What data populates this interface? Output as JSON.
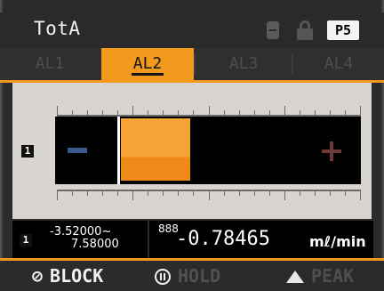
{
  "header": {
    "title": "TotA",
    "preset": "P5"
  },
  "tabs": [
    {
      "label": "AL1",
      "active": false
    },
    {
      "label": "AL2",
      "active": true
    },
    {
      "label": "AL3",
      "active": false
    },
    {
      "label": "AL4",
      "active": false
    }
  ],
  "channel": "1",
  "bar": {
    "negative_symbol": "−",
    "positive_symbol": "+"
  },
  "reading": {
    "channel": "1",
    "range_low": "-3.52000~",
    "range_high": "7.58000",
    "digits": "888",
    "value": "-0.78465",
    "unit": "mℓ/min"
  },
  "footer": {
    "block": "BLOCK",
    "hold": "HOLD",
    "peak": "PEAK"
  },
  "colors": {
    "accent": "#f39a1e",
    "negative": "#385b8e",
    "positive": "#6e3a38"
  }
}
